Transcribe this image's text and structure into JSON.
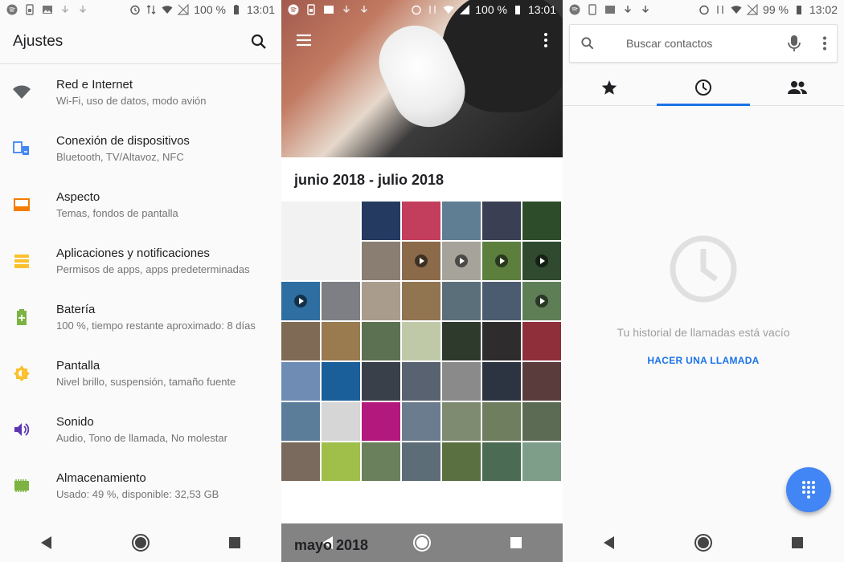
{
  "screen1": {
    "status": {
      "battery": "100 %",
      "time": "13:01"
    },
    "title": "Ajustes",
    "items": [
      {
        "title": "Red e Internet",
        "subtitle": "Wi-Fi, uso de datos, modo avión",
        "icon": "wifi-icon",
        "color": "#5f6368"
      },
      {
        "title": "Conexión de dispositivos",
        "subtitle": "Bluetooth, TV/Altavoz, NFC",
        "icon": "devices-icon",
        "color": "#4285f4"
      },
      {
        "title": "Aspecto",
        "subtitle": "Temas, fondos de pantalla",
        "icon": "wallpaper-icon",
        "color": "#f57c00"
      },
      {
        "title": "Aplicaciones y notificaciones",
        "subtitle": "Permisos de apps, apps predeterminadas",
        "icon": "apps-icon",
        "color": "#fbc02d"
      },
      {
        "title": "Batería",
        "subtitle": "100 %, tiempo restante aproximado: 8 días",
        "icon": "battery-icon",
        "color": "#7cb342"
      },
      {
        "title": "Pantalla",
        "subtitle": "Nivel brillo, suspensión, tamaño fuente",
        "icon": "brightness-icon",
        "color": "#fbc02d"
      },
      {
        "title": "Sonido",
        "subtitle": "Audio, Tono de llamada, No molestar",
        "icon": "volume-icon",
        "color": "#5e35b1"
      },
      {
        "title": "Almacenamiento",
        "subtitle": "Usado: 49 %, disponible: 32,53 GB",
        "icon": "storage-icon",
        "color": "#7cb342"
      }
    ]
  },
  "screen2": {
    "status": {
      "battery": "100 %",
      "time": "13:01"
    },
    "section1": "junio 2018 - julio 2018",
    "section2": "mayo 2018",
    "thumbnail_colors": [
      "#243a60",
      "#c33e5c",
      "#5f7d93",
      "#3a3f54",
      "#2d4c2a",
      "#8a7d72",
      "#8b6a4a",
      "#a5a39a",
      "#5c7f3e",
      "#2f4a2e",
      "#2e6ea1",
      "#7d7f84",
      "#a99c8d",
      "#917450",
      "#5b6f7a",
      "#4b5b70",
      "#5e7e56",
      "#7e6a55",
      "#9a7a4f",
      "#5c7052",
      "#bfc9a8",
      "#2e3a2b",
      "#2e2c2c",
      "#8e2f3a",
      "#6f8db4",
      "#1b5f9a",
      "#3a4049",
      "#586270",
      "#8a8a8a",
      "#2b3440",
      "#5a3c3c",
      "#5b7d9a",
      "#d6d6d6",
      "#b3187d",
      "#6b7c8f",
      "#7f8b70",
      "#6f7e5e",
      "#5c6b54",
      "#7a6a5e",
      "#9fbf4a",
      "#6a7f5c",
      "#5d6d78",
      "#5a7040",
      "#4c6b55",
      "#7e9e8a"
    ]
  },
  "screen3": {
    "status": {
      "battery": "99 %",
      "time": "13:02"
    },
    "search_placeholder": "Buscar contactos",
    "empty_message": "Tu historial de llamadas está vacío",
    "cta": "HACER UNA LLAMADA"
  }
}
